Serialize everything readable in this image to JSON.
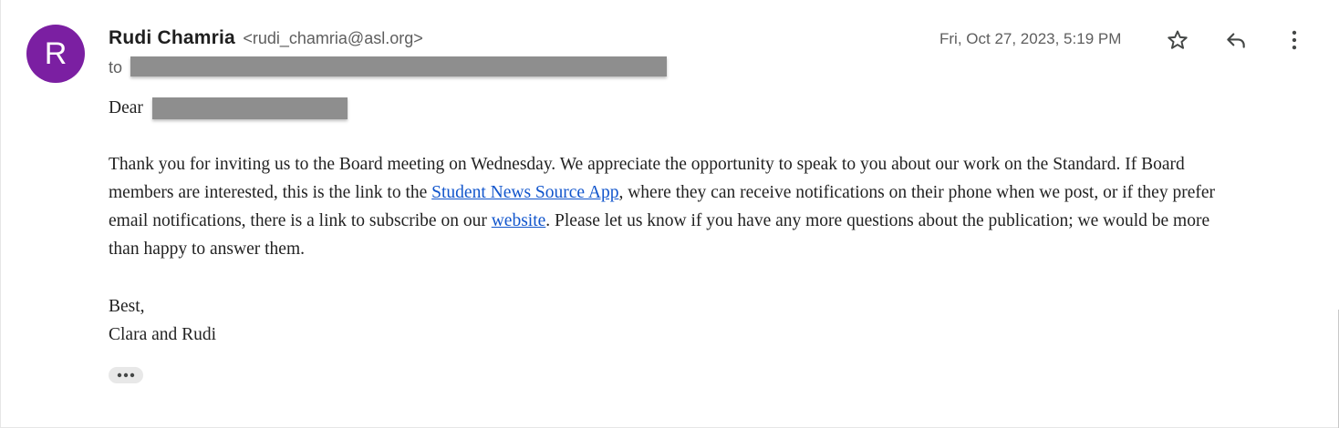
{
  "sender": {
    "avatar_letter": "R",
    "avatar_color": "#7b1fa2",
    "name": "Rudi Chamria",
    "email": "<rudi_chamria@asl.org>"
  },
  "recipients": {
    "to_label": "to"
  },
  "date": "Fri, Oct 27, 2023, 5:19 PM",
  "actions": {
    "star_icon": "star-outline-icon",
    "reply_icon": "reply-icon",
    "more_icon": "more-vert-icon"
  },
  "body": {
    "greeting": "Dear",
    "line1": "Thank you for inviting us to the Board meeting on Wednesday. We appreciate the opportunity to speak to you about our work on the Standard. If Board",
    "line2_pre": "members are interested, this is the link to the ",
    "link_app": "Student News Source App",
    "line2_post": ", where they can receive notifications on their phone when we post, or if they prefer",
    "line3_pre": "email notifications, there is a link to subscribe on our ",
    "link_website": "website",
    "line3_post": ". Please let us know if you have any more questions about the publication; we would be more",
    "line4": "than happy to answer them.",
    "closing": "Best,",
    "signature": "Clara and Rudi"
  },
  "colors": {
    "link": "#1155cc",
    "text": "#222222",
    "muted": "#5e5e5e"
  }
}
